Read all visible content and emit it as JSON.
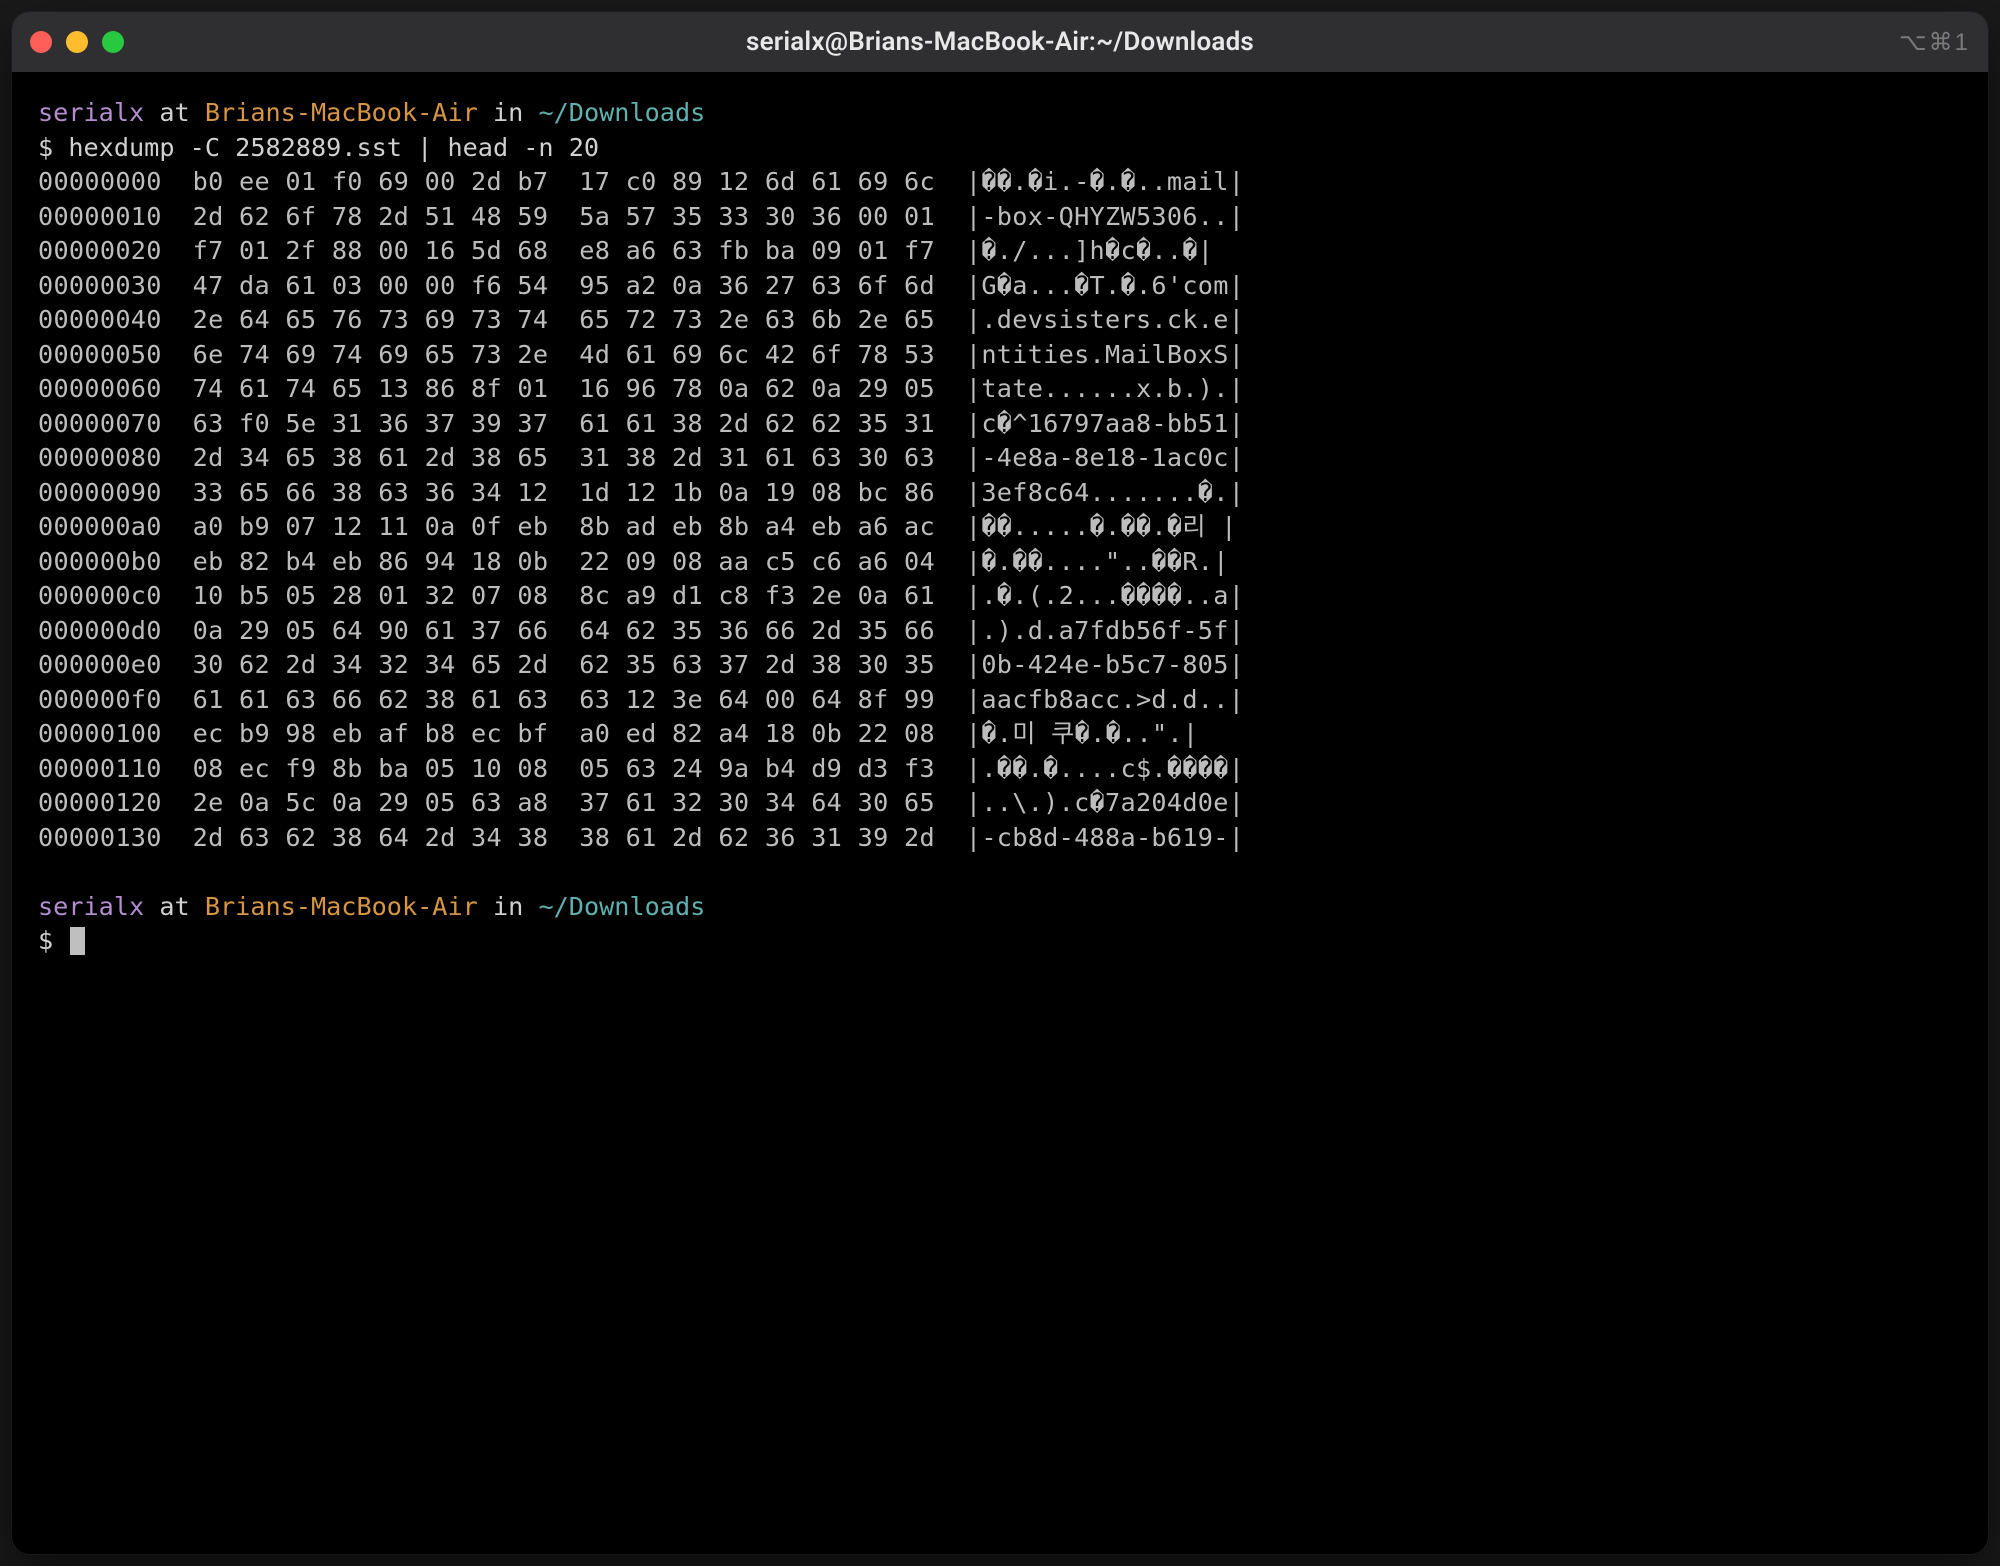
{
  "window": {
    "title": "serialx@Brians-MacBook-Air:~/Downloads",
    "shortcut": "⌥⌘1"
  },
  "prompt": {
    "user": "serialx",
    "at": " at ",
    "host": "Brians-MacBook-Air",
    "in": " in ",
    "path": "~/Downloads",
    "sign": "$ "
  },
  "command": "hexdump -C 2582889.sst | head -n 20",
  "hex_rows": [
    {
      "offset": "00000000",
      "h1": "b0 ee 01 f0 69 00 2d b7",
      "h2": "17 c0 89 12 6d 61 69 6c",
      "ascii": "|��.�i.-�.�..mail|"
    },
    {
      "offset": "00000010",
      "h1": "2d 62 6f 78 2d 51 48 59",
      "h2": "5a 57 35 33 30 36 00 01",
      "ascii": "|-box-QHYZW5306..|"
    },
    {
      "offset": "00000020",
      "h1": "f7 01 2f 88 00 16 5d 68",
      "h2": "e8 a6 63 fb ba 09 01 f7",
      "ascii": "|�./...]h�c�..�|"
    },
    {
      "offset": "00000030",
      "h1": "47 da 61 03 00 00 f6 54",
      "h2": "95 a2 0a 36 27 63 6f 6d",
      "ascii": "|G�a...�T.�.6'com|"
    },
    {
      "offset": "00000040",
      "h1": "2e 64 65 76 73 69 73 74",
      "h2": "65 72 73 2e 63 6b 2e 65",
      "ascii": "|.devsisters.ck.e|"
    },
    {
      "offset": "00000050",
      "h1": "6e 74 69 74 69 65 73 2e",
      "h2": "4d 61 69 6c 42 6f 78 53",
      "ascii": "|ntities.MailBoxS|"
    },
    {
      "offset": "00000060",
      "h1": "74 61 74 65 13 86 8f 01",
      "h2": "16 96 78 0a 62 0a 29 05",
      "ascii": "|tate......x.b.).|"
    },
    {
      "offset": "00000070",
      "h1": "63 f0 5e 31 36 37 39 37",
      "h2": "61 61 38 2d 62 62 35 31",
      "ascii": "|c�^16797aa8-bb51|"
    },
    {
      "offset": "00000080",
      "h1": "2d 34 65 38 61 2d 38 65",
      "h2": "31 38 2d 31 61 63 30 63",
      "ascii": "|-4e8a-8e18-1ac0c|"
    },
    {
      "offset": "00000090",
      "h1": "33 65 66 38 63 36 34 12",
      "h2": "1d 12 1b 0a 19 08 bc 86",
      "ascii": "|3ef8c64.......�.|"
    },
    {
      "offset": "000000a0",
      "h1": "a0 b9 07 12 11 0a 0f eb",
      "h2": "8b ad eb 8b a4 eb a6 ac",
      "ascii": "|��.....�.��.�리 |"
    },
    {
      "offset": "000000b0",
      "h1": "eb 82 b4 eb 86 94 18 0b",
      "h2": "22 09 08 aa c5 c6 a6 04",
      "ascii": "|�.��....\"..��R.|"
    },
    {
      "offset": "000000c0",
      "h1": "10 b5 05 28 01 32 07 08",
      "h2": "8c a9 d1 c8 f3 2e 0a 61",
      "ascii": "|.�.(.2...����..a|"
    },
    {
      "offset": "000000d0",
      "h1": "0a 29 05 64 90 61 37 66",
      "h2": "64 62 35 36 66 2d 35 66",
      "ascii": "|.).d.a7fdb56f-5f|"
    },
    {
      "offset": "000000e0",
      "h1": "30 62 2d 34 32 34 65 2d",
      "h2": "62 35 63 37 2d 38 30 35",
      "ascii": "|0b-424e-b5c7-805|"
    },
    {
      "offset": "000000f0",
      "h1": "61 61 63 66 62 38 61 63",
      "h2": "63 12 3e 64 00 64 8f 99",
      "ascii": "|aacfb8acc.>d.d..|"
    },
    {
      "offset": "00000100",
      "h1": "ec b9 98 eb af b8 ec bf",
      "h2": "a0 ed 82 a4 18 0b 22 08",
      "ascii": "|�.미 쿠�.�..\".|"
    },
    {
      "offset": "00000110",
      "h1": "08 ec f9 8b ba 05 10 08",
      "h2": "05 63 24 9a b4 d9 d3 f3",
      "ascii": "|.��.�....c$.����|"
    },
    {
      "offset": "00000120",
      "h1": "2e 0a 5c 0a 29 05 63 a8",
      "h2": "37 61 32 30 34 64 30 65",
      "ascii": "|..\\.).c�7a204d0e|"
    },
    {
      "offset": "00000130",
      "h1": "2d 63 62 38 64 2d 34 38",
      "h2": "38 61 2d 62 36 31 39 2d",
      "ascii": "|-cb8d-488a-b619-|"
    }
  ]
}
